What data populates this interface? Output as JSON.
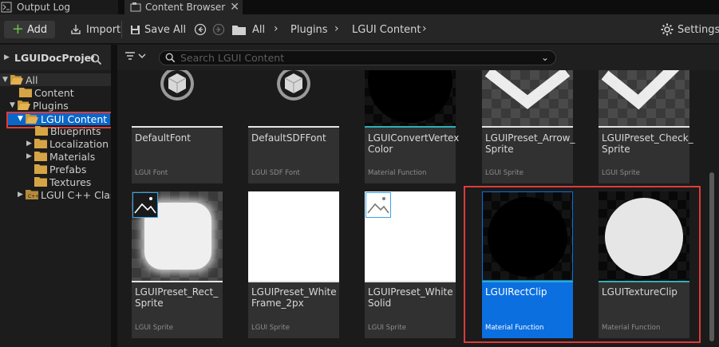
{
  "tabs": {
    "output_log": "Output Log",
    "content_browser": "Content Browser",
    "close": "✕"
  },
  "toolbar": {
    "add": "Add",
    "import": "Import",
    "save_all": "Save All",
    "breadcrumbs": [
      "All",
      "Plugins",
      "LGUI Content"
    ],
    "settings": "Settings"
  },
  "left_panel": {
    "title": "LGUIDocProject",
    "tree": [
      {
        "label": "All"
      },
      {
        "label": "Content"
      },
      {
        "label": "Plugins"
      },
      {
        "label": "LGUI Content"
      },
      {
        "label": "Blueprints"
      },
      {
        "label": "Localization"
      },
      {
        "label": "Materials"
      },
      {
        "label": "Prefabs"
      },
      {
        "label": "Textures"
      },
      {
        "label": "LGUI C++ Classes"
      }
    ]
  },
  "search": {
    "placeholder": "Search LGUI Content"
  },
  "assets": [
    {
      "name": "DefaultFont",
      "type": "LGUI Font"
    },
    {
      "name": "DefaultSDFFont",
      "type": "LGUI SDF Font"
    },
    {
      "name": "LGUIConvertVertex Color",
      "type": "Material Function"
    },
    {
      "name": "LGUIPreset_Arrow_ Sprite",
      "type": "LGUI Sprite"
    },
    {
      "name": "LGUIPreset_Check_ Sprite",
      "type": "LGUI Sprite"
    },
    {
      "name": "LGUIPreset_Rect_ Sprite",
      "type": "LGUI Sprite"
    },
    {
      "name": "LGUIPreset_White Frame_2px",
      "type": "LGUI Sprite"
    },
    {
      "name": "LGUIPreset_White Solid",
      "type": "LGUI Sprite"
    },
    {
      "name": "LGUIRectClip",
      "type": "Material Function"
    },
    {
      "name": "LGUITextureClip",
      "type": "Material Function"
    }
  ],
  "colors": {
    "selection": "#0b6fe0",
    "highlight": "#e03a3a",
    "material_function_bar": "#2fb0b6",
    "add_plus": "#68c34b"
  }
}
